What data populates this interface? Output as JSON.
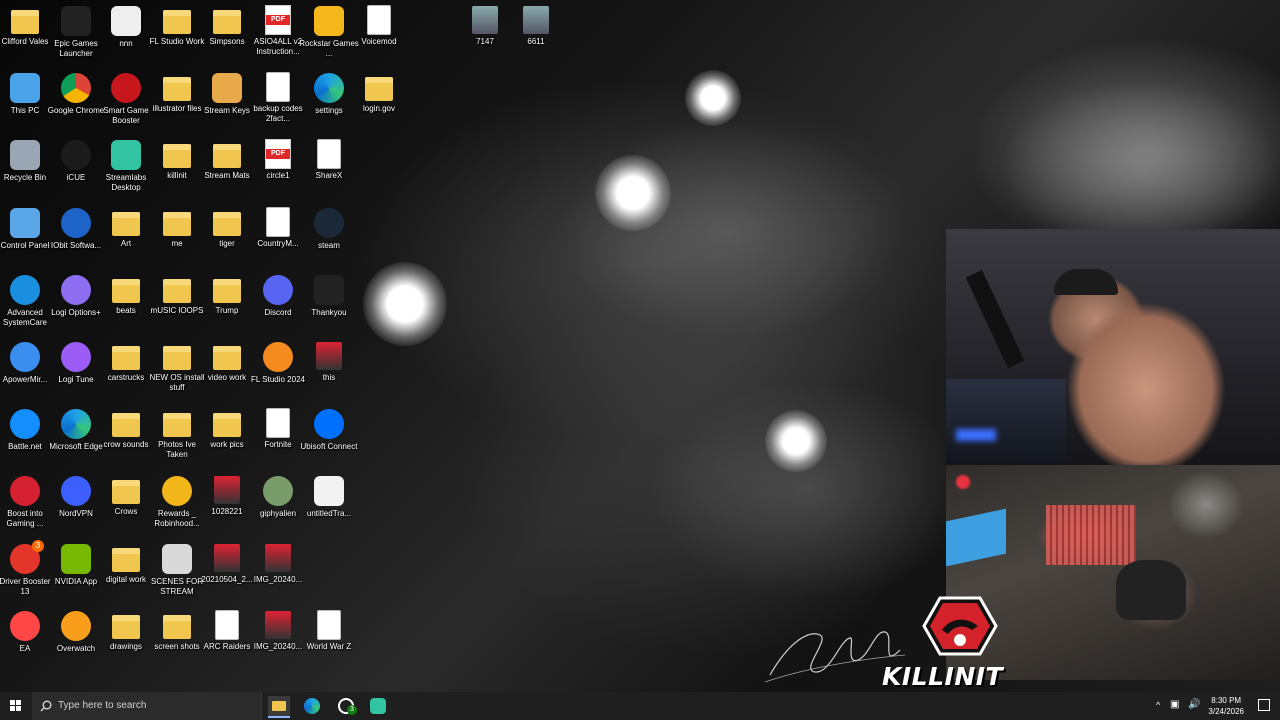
{
  "desktop": {
    "icons": [
      {
        "label": "Clifford Vales",
        "icon": "folder-icon"
      },
      {
        "label": "Epic Games Launcher",
        "icon": "epic-games-icon"
      },
      {
        "label": "nnn",
        "icon": "window-icon"
      },
      {
        "label": "FL Studio Work",
        "icon": "folder-icon"
      },
      {
        "label": "Simpsons",
        "icon": "folder-icon"
      },
      {
        "label": "ASIO4ALL v2 Instruction...",
        "icon": "pdf-icon"
      },
      {
        "label": "Rockstar Games ...",
        "icon": "rockstar-icon"
      },
      {
        "label": "Voicemod",
        "icon": "document-icon"
      },
      {
        "label": "This PC",
        "icon": "computer-icon"
      },
      {
        "label": "Google Chrome",
        "icon": "chrome-icon"
      },
      {
        "label": "Smart Game Booster",
        "icon": "game-booster-icon"
      },
      {
        "label": "illustrator files",
        "icon": "folder-icon"
      },
      {
        "label": "Stream Keys",
        "icon": "key-icon"
      },
      {
        "label": "backup codes 2fact...",
        "icon": "document-icon"
      },
      {
        "label": "settings",
        "icon": "edge-icon"
      },
      {
        "label": "login.gov",
        "icon": "folder-icon"
      },
      {
        "label": "Recycle Bin",
        "icon": "recycle-bin-icon"
      },
      {
        "label": "iCUE",
        "icon": "icue-icon"
      },
      {
        "label": "Streamlabs Desktop",
        "icon": "streamlabs-icon"
      },
      {
        "label": "killinit",
        "icon": "folder-icon"
      },
      {
        "label": "Stream Mats",
        "icon": "folder-icon"
      },
      {
        "label": "circle1",
        "icon": "pdf-icon"
      },
      {
        "label": "ShareX",
        "icon": "document-icon"
      },
      {
        "label": "Control Panel",
        "icon": "control-panel-icon"
      },
      {
        "label": "IObit Softwa...",
        "icon": "iobit-icon"
      },
      {
        "label": "Art",
        "icon": "folder-icon"
      },
      {
        "label": "me",
        "icon": "folder-icon"
      },
      {
        "label": "tiger",
        "icon": "folder-icon"
      },
      {
        "label": "CountryM...",
        "icon": "document-icon"
      },
      {
        "label": "steam",
        "icon": "steam-icon"
      },
      {
        "label": "Advanced SystemCare",
        "icon": "systemcare-icon"
      },
      {
        "label": "Logi Options+",
        "icon": "logi-icon"
      },
      {
        "label": "beats",
        "icon": "folder-icon"
      },
      {
        "label": "mUSIC lOOPS",
        "icon": "folder-icon"
      },
      {
        "label": "Trump",
        "icon": "folder-icon"
      },
      {
        "label": "Discord",
        "icon": "discord-icon"
      },
      {
        "label": "Thankyou",
        "icon": "thankyou-icon"
      },
      {
        "label": "ApowerMir...",
        "icon": "apowermirror-icon"
      },
      {
        "label": "Logi Tune",
        "icon": "logi-tune-icon"
      },
      {
        "label": "carstrucks",
        "icon": "folder-icon"
      },
      {
        "label": "NEW OS install stuff",
        "icon": "folder-icon"
      },
      {
        "label": "video work",
        "icon": "folder-icon"
      },
      {
        "label": "FL Studio 2024",
        "icon": "fl-studio-icon"
      },
      {
        "label": "this",
        "icon": "image-icon"
      },
      {
        "label": "Battle.net",
        "icon": "battlenet-icon"
      },
      {
        "label": "Microsoft Edge",
        "icon": "edge-icon"
      },
      {
        "label": "crow sounds",
        "icon": "folder-icon"
      },
      {
        "label": "Photos Ive Taken",
        "icon": "folder-icon"
      },
      {
        "label": "work pics",
        "icon": "folder-icon"
      },
      {
        "label": "Fortnite",
        "icon": "document-icon"
      },
      {
        "label": "Ubisoft Connect",
        "icon": "ubisoft-icon"
      },
      {
        "label": "Boost into Gaming ...",
        "icon": "boost-icon"
      },
      {
        "label": "NordVPN",
        "icon": "nordvpn-icon"
      },
      {
        "label": "Crows",
        "icon": "folder-icon"
      },
      {
        "label": "Rewards _ Robinhood...",
        "icon": "star-icon"
      },
      {
        "label": "1028221",
        "icon": "image-icon"
      },
      {
        "label": "giphyalien",
        "icon": "alien-icon"
      },
      {
        "label": "untitledTra...",
        "icon": "video-icon"
      },
      {
        "label": "Driver Booster 13",
        "icon": "driver-booster-icon"
      },
      {
        "label": "NVIDIA App",
        "icon": "nvidia-icon"
      },
      {
        "label": "digital work",
        "icon": "folder-icon"
      },
      {
        "label": "SCENES FOR STREAM",
        "icon": "scenes-icon"
      },
      {
        "label": "20210504_2...",
        "icon": "image-icon"
      },
      {
        "label": "IMG_20240...",
        "icon": "image-icon"
      },
      {
        "label": "EA",
        "icon": "ea-icon"
      },
      {
        "label": "Overwatch",
        "icon": "overwatch-icon"
      },
      {
        "label": "drawings",
        "icon": "folder-icon"
      },
      {
        "label": "screen shots",
        "icon": "folder-icon"
      },
      {
        "label": "ARC Raiders",
        "icon": "document-icon"
      },
      {
        "label": "IMG_20240...",
        "icon": "image-icon"
      },
      {
        "label": "World War Z",
        "icon": "document-icon"
      },
      {
        "label": "7147",
        "icon": "photo-icon"
      },
      {
        "label": "6611",
        "icon": "photo-icon"
      }
    ],
    "badges": {
      "driver_booster": "3"
    }
  },
  "overlay": {
    "brand_text": "KILLINIT",
    "signature_note": "handwritten signature"
  },
  "taskbar": {
    "search_placeholder": "Type here to search",
    "xbox_badge": "3",
    "time": "8:30 PM",
    "date": "3/24/2026"
  },
  "colors": {
    "taskbar": "#1f1f1f",
    "folder": "#f0c64f",
    "accent_red": "#e0282a"
  }
}
